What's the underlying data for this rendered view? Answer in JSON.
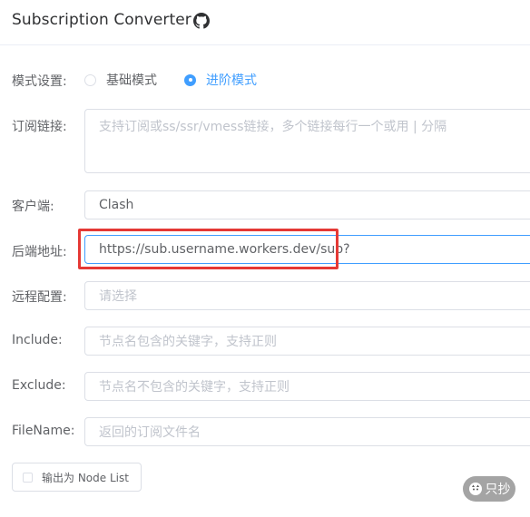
{
  "header": {
    "title": "Subscription Converter",
    "github_icon": "github-icon"
  },
  "mode": {
    "label": "模式设置:",
    "options": [
      {
        "label": "基础模式",
        "checked": false
      },
      {
        "label": "进阶模式",
        "checked": true
      }
    ]
  },
  "subscription": {
    "label": "订阅链接:",
    "placeholder": "支持订阅或ss/ssr/vmess链接，多个链接每行一个或用 | 分隔"
  },
  "client": {
    "label": "客户端:",
    "value": "Clash"
  },
  "backend": {
    "label": "后端地址:",
    "value": "https://sub.username.workers.dev/sub?"
  },
  "remote_config": {
    "label": "远程配置:",
    "placeholder": "请选择"
  },
  "include": {
    "label": "Include:",
    "placeholder": "节点名包含的关键字，支持正则"
  },
  "exclude": {
    "label": "Exclude:",
    "placeholder": "节点名不包含的关键字，支持正则"
  },
  "filename": {
    "label": "FileName:",
    "placeholder": "返回的订阅文件名"
  },
  "node_list": {
    "label": "输出为 Node List",
    "checked": false
  },
  "watermark": {
    "text": "只抄",
    "icon": "cat-logo-icon"
  },
  "colors": {
    "accent": "#409eff",
    "highlight": "#e53935",
    "border": "#dcdfe6",
    "placeholder": "#c0c4cc"
  }
}
